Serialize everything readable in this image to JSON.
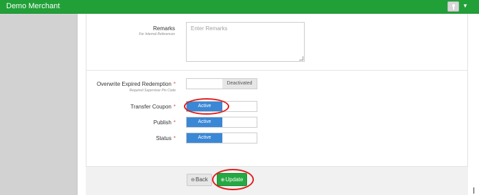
{
  "header": {
    "brand": "Demo Merchant",
    "menu_caret": "▼"
  },
  "form": {
    "remarks": {
      "label": "Remarks",
      "hint": "For Internal References",
      "placeholder": "Enter Remarks"
    },
    "overwrite_expired": {
      "label": "Overwrite Expired Redemption",
      "required": "*",
      "hint": "Required Supervisor Pin Code",
      "state": "Deactivated"
    },
    "transfer_coupon": {
      "label": "Transfer Coupon",
      "required": "*",
      "state": "Active"
    },
    "publish": {
      "label": "Publish",
      "required": "*",
      "state": "Active"
    },
    "status": {
      "label": "Status",
      "required": "*",
      "state": "Active"
    }
  },
  "footer": {
    "back_label": "Back",
    "update_label": "Update",
    "back_glyph": "⊖",
    "update_glyph": "⊕"
  },
  "colors": {
    "topbar": "#21a038",
    "toggle_active": "#3a87d6",
    "update_button": "#25a842",
    "annotation": "#e21b1b"
  }
}
